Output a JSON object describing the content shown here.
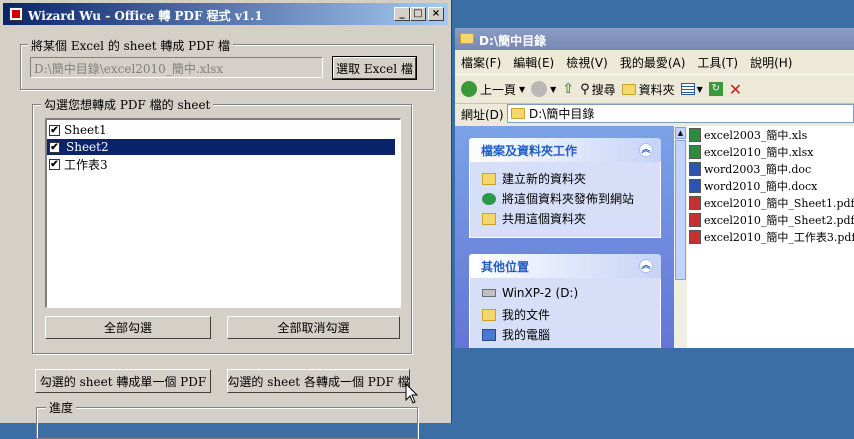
{
  "app_window": {
    "title": "Wizard Wu - Office 轉 PDF 程式 v1.1",
    "controls": {
      "minimize": "_",
      "maximize": "□",
      "close": "×"
    },
    "file_group": {
      "title": "將某個 Excel 的 sheet 轉成 PDF 檔",
      "path_value": "D:\\簡中目錄\\excel2010_簡中.xlsx",
      "select_button": "選取 Excel 檔"
    },
    "sheet_group": {
      "title": "勾選您想轉成 PDF 檔的 sheet",
      "sheets": [
        {
          "label": "Sheet1",
          "checked": "✔"
        },
        {
          "label": "Sheet2",
          "checked": "✔"
        },
        {
          "label": "工作表3",
          "checked": "✔"
        }
      ],
      "select_all": "全部勾選",
      "deselect_all": "全部取消勾選"
    },
    "convert_single": "勾選的 sheet 轉成單一個 PDF",
    "convert_each": "勾選的 sheet 各轉成一個 PDF 檔",
    "progress_title": "進度"
  },
  "explorer": {
    "title": "D:\\簡中目錄",
    "menu": [
      "檔案(F)",
      "編輯(E)",
      "檢視(V)",
      "我的最愛(A)",
      "工具(T)",
      "說明(H)"
    ],
    "toolbar": {
      "back": "上一頁",
      "search": "搜尋",
      "folders": "資料夾"
    },
    "address_label": "網址(D)",
    "address_value": "D:\\簡中目錄",
    "tasks_panel": {
      "title": "檔案及資料夾工作",
      "items": [
        "建立新的資料夾",
        "將這個資料夾發佈到網站",
        "共用這個資料夾"
      ]
    },
    "places_panel": {
      "title": "其他位置",
      "items": [
        "WinXP-2 (D:)",
        "我的文件",
        "我的電腦"
      ]
    },
    "files": [
      {
        "name": "excel2003_簡中.xls",
        "icon": "excel-icon"
      },
      {
        "name": "excel2010_簡中.xlsx",
        "icon": "excel-icon"
      },
      {
        "name": "word2003_簡中.doc",
        "icon": "word-icon"
      },
      {
        "name": "word2010_簡中.docx",
        "icon": "word-icon"
      },
      {
        "name": "excel2010_簡中_Sheet1.pdf",
        "icon": "pdf-icon"
      },
      {
        "name": "excel2010_簡中_Sheet2.pdf",
        "icon": "pdf-icon"
      },
      {
        "name": "excel2010_簡中_工作表3.pdf",
        "icon": "pdf-icon"
      }
    ]
  },
  "colors": {
    "selection": "#0a246a",
    "desktop": "#3a6ea5"
  }
}
